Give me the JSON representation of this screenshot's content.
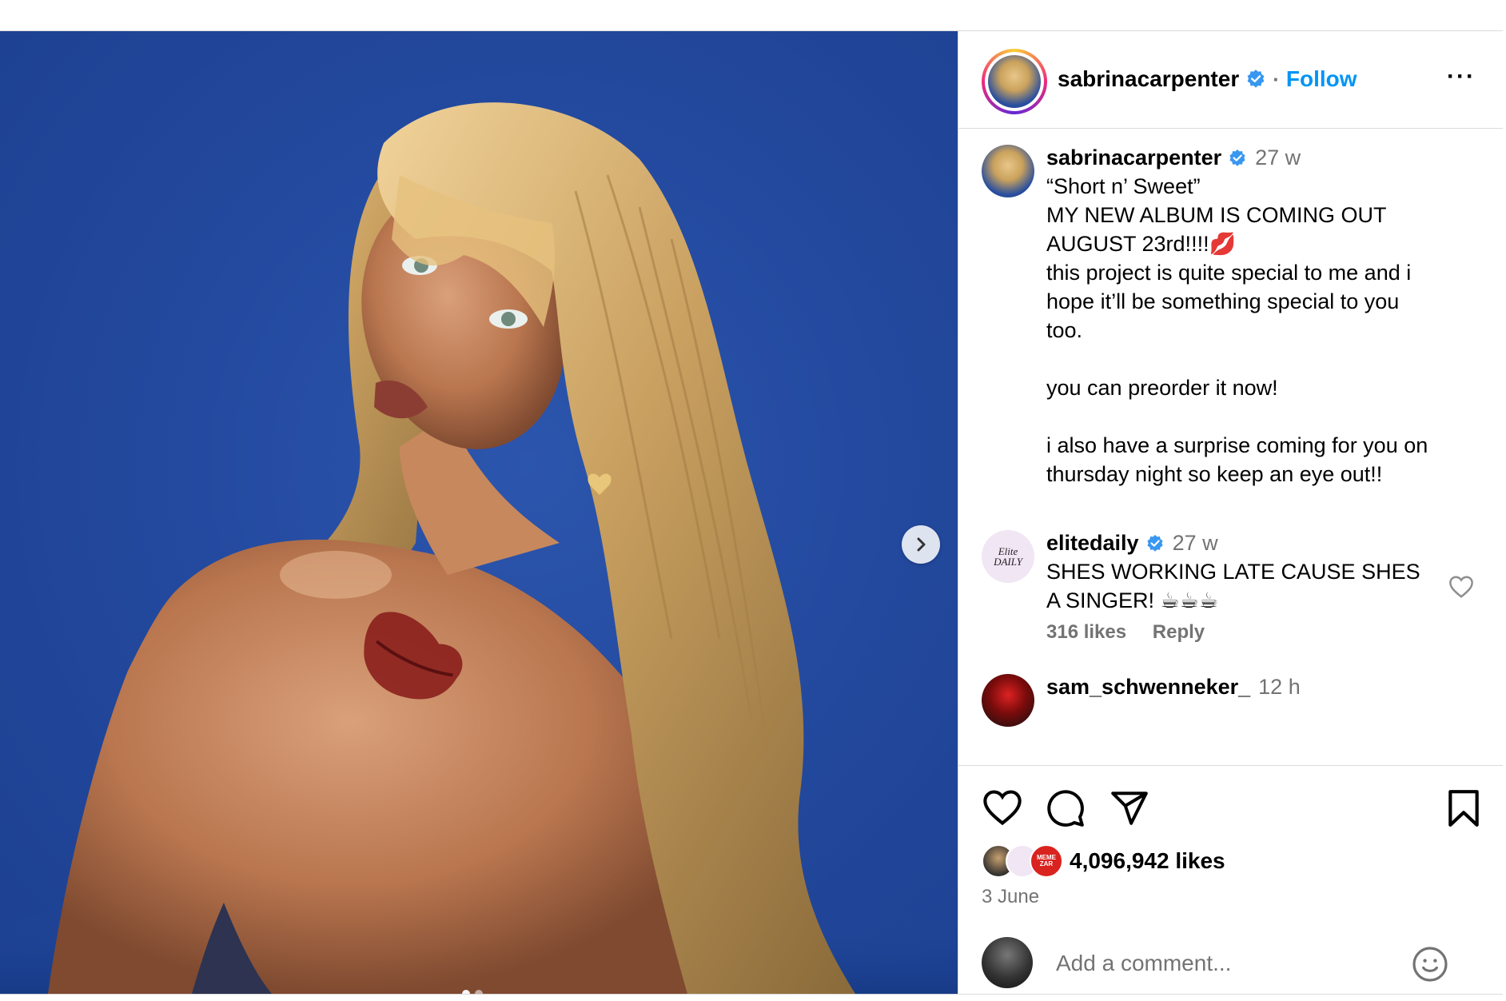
{
  "header": {
    "username": "sabrinacarpenter",
    "separator": "·",
    "follow_label": "Follow",
    "more_label": "···"
  },
  "caption": {
    "username": "sabrinacarpenter",
    "time": "27 w",
    "text": "“Short n’ Sweet”\nMY NEW ALBUM IS COMING OUT\nAUGUST 23rd!!!!💋\nthis project is quite special to me and i\nhope it’ll be something special to you\ntoo.\n\nyou can preorder it now!\n\ni also have a surprise coming for you on\nthursday night so keep an eye out!!"
  },
  "comments": [
    {
      "username": "elitedaily",
      "avatar_text": "Elite DAILY",
      "time": "27 w",
      "text": "SHES WORKING LATE CAUSE SHES\nA SINGER! ☕☕☕",
      "likes": "316 likes",
      "reply_label": "Reply"
    },
    {
      "username": "sam_schwenneker_",
      "time": "12 h"
    }
  ],
  "actions": {
    "likes": "4,096,942 likes",
    "date": "3 June",
    "mini_avatar_text": "MEME ZAR",
    "comment_placeholder": "Add a comment..."
  },
  "media": {
    "slide_index": 1,
    "slide_count": 2
  },
  "colors": {
    "accent": "#0095f6",
    "verified": "#3897f0",
    "muted": "#737373",
    "border": "#dbdbdb",
    "sky": "#2a51a8"
  }
}
